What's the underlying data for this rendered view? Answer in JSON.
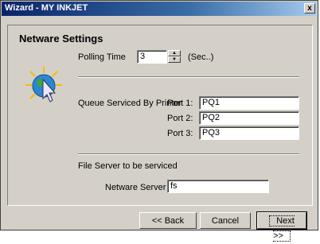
{
  "window": {
    "title": "Wizard - MY INKJET",
    "close_label": "x"
  },
  "panel": {
    "title": "Netware Settings"
  },
  "polling": {
    "label": "Polling Time",
    "value": "3",
    "unit": "(Sec..)"
  },
  "queue": {
    "label": "Queue Serviced By Printer",
    "ports": [
      {
        "label": "Port 1:",
        "value": "PQ1"
      },
      {
        "label": "Port 2:",
        "value": "PQ2"
      },
      {
        "label": "Port 3:",
        "value": "PQ3"
      }
    ]
  },
  "fileserver": {
    "section_label": "File Server to be serviced",
    "label": "Netware Server",
    "value": "fs"
  },
  "buttons": {
    "back": "<< Back",
    "cancel": "Cancel",
    "next": "Next >>"
  },
  "icons": {
    "logo": "globe-printer-cursor-icon",
    "close": "close-icon",
    "spin_up": "arrow-up-icon",
    "spin_down": "arrow-down-icon"
  }
}
